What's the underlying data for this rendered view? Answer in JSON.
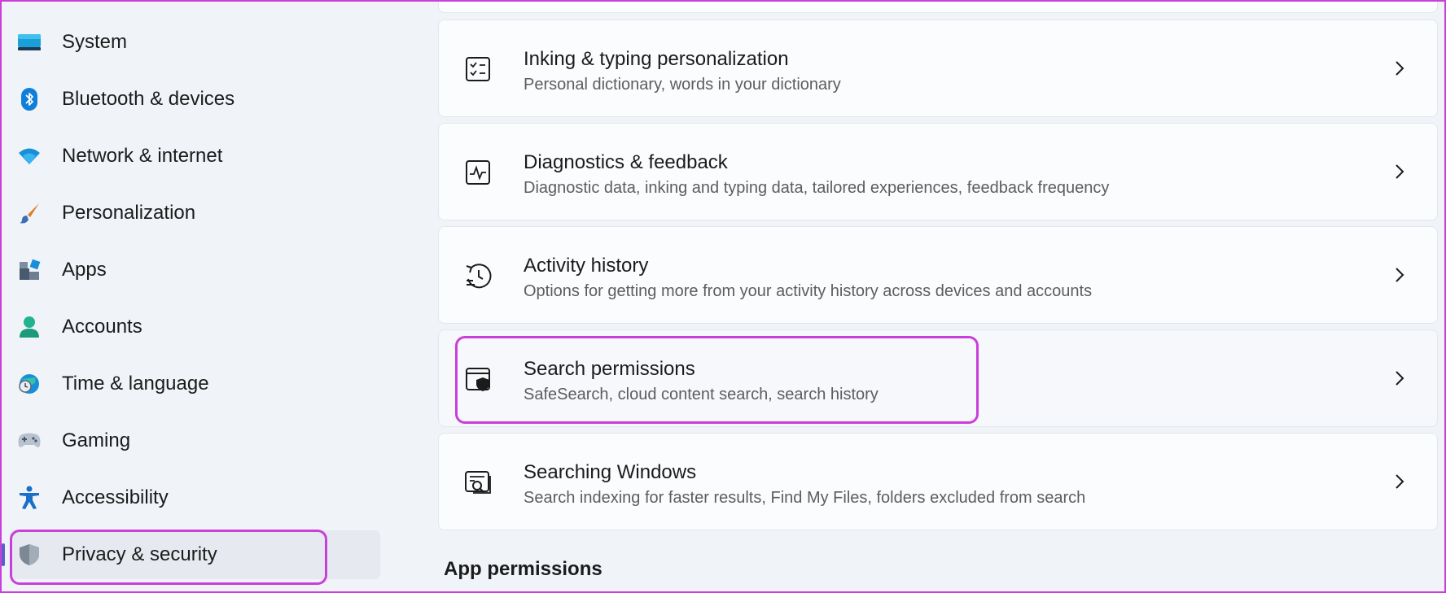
{
  "sidebar": {
    "items": [
      {
        "label": "System",
        "icon": "system-icon"
      },
      {
        "label": "Bluetooth & devices",
        "icon": "bluetooth-icon"
      },
      {
        "label": "Network & internet",
        "icon": "wifi-icon"
      },
      {
        "label": "Personalization",
        "icon": "brush-icon"
      },
      {
        "label": "Apps",
        "icon": "apps-icon"
      },
      {
        "label": "Accounts",
        "icon": "person-icon"
      },
      {
        "label": "Time & language",
        "icon": "globe-clock-icon"
      },
      {
        "label": "Gaming",
        "icon": "gamepad-icon"
      },
      {
        "label": "Accessibility",
        "icon": "accessibility-icon"
      },
      {
        "label": "Privacy & security",
        "icon": "shield-icon",
        "selected": true
      }
    ]
  },
  "main": {
    "cards": [
      {
        "title": "Inking & typing personalization",
        "subtitle": "Personal dictionary, words in your dictionary",
        "icon": "checklist-icon"
      },
      {
        "title": "Diagnostics & feedback",
        "subtitle": "Diagnostic data, inking and typing data, tailored experiences, feedback frequency",
        "icon": "pulse-icon"
      },
      {
        "title": "Activity history",
        "subtitle": "Options for getting more from your activity history across devices and accounts",
        "icon": "history-icon"
      },
      {
        "title": "Search permissions",
        "subtitle": "SafeSearch, cloud content search, search history",
        "icon": "search-shield-icon"
      },
      {
        "title": "Searching Windows",
        "subtitle": "Search indexing for faster results, Find My Files, folders excluded from search",
        "icon": "search-window-icon"
      }
    ],
    "section_heading": "App permissions"
  },
  "colors": {
    "highlight": "#c83fd9",
    "accent": "#0078d4",
    "background": "#f0f4f9"
  }
}
